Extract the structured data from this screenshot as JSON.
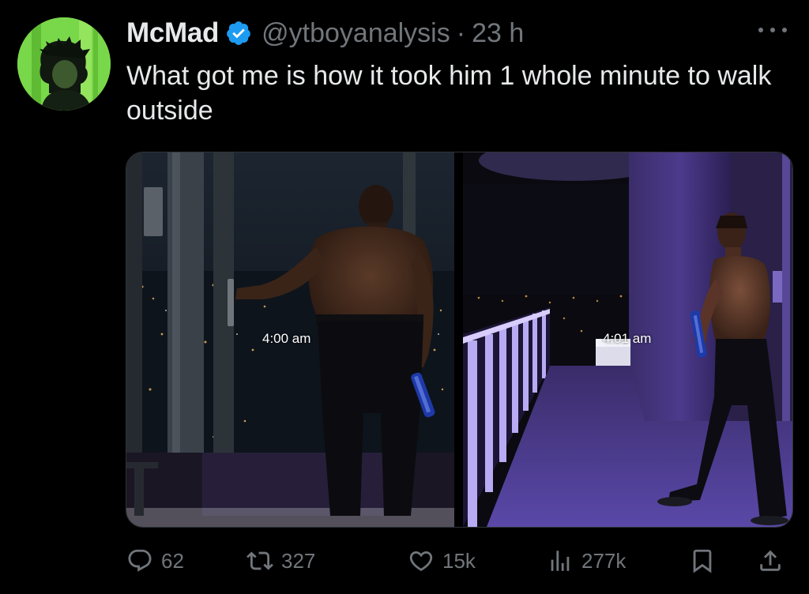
{
  "tweet": {
    "author_name": "McMad",
    "handle": "@ytboyanalysis",
    "separator": "·",
    "time": "23 h",
    "text": "What got me is how it took him 1 whole minute to walk outside",
    "verified_color": "#1d9bf0"
  },
  "media": {
    "left_caption": "4:00 am",
    "right_caption": "4:01 am"
  },
  "actions": {
    "replies": "62",
    "retweets": "327",
    "likes": "15k",
    "views": "277k"
  },
  "icons": {
    "reply": "reply-icon",
    "retweet": "retweet-icon",
    "like": "heart-icon",
    "views": "views-icon",
    "bookmark": "bookmark-icon",
    "share": "share-icon",
    "more": "more-icon",
    "verified": "verified-badge-icon"
  },
  "colors": {
    "background": "#000000",
    "text_primary": "#e7e9ea",
    "text_secondary": "#71767b",
    "accent": "#1d9bf0"
  }
}
